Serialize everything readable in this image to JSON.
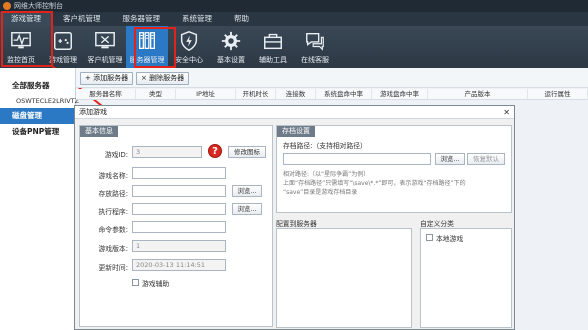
{
  "window": {
    "title": "网维大师控制台"
  },
  "menu": [
    "游戏管理",
    "客户机管理",
    "服务器管理",
    "系统管理",
    "帮助"
  ],
  "toolbar": [
    {
      "label": "监控首页",
      "icon": "monitor-pulse-icon"
    },
    {
      "label": "游戏管理",
      "icon": "gamepad-icon"
    },
    {
      "label": "客户机管理",
      "icon": "computer-tools-icon"
    },
    {
      "label": "服务器管理",
      "icon": "server-icon"
    },
    {
      "label": "安全中心",
      "icon": "shield-bolt-icon"
    },
    {
      "label": "基本设置",
      "icon": "gear-icon"
    },
    {
      "label": "辅助工具",
      "icon": "toolbox-icon"
    },
    {
      "label": "在线客服",
      "icon": "chat-icon"
    }
  ],
  "sidebar": {
    "all_servers": "全部服务器",
    "server_id": "OSWTECLE2LRIVTZ",
    "disk_mgmt": "磁盘管理",
    "pnp_mgmt": "设备PNP管理"
  },
  "actions": {
    "add_server": "添加服务器",
    "delete_server": "删除服务器"
  },
  "table_headers": [
    "服务器名称",
    "类型",
    "IP地址",
    "开机时长",
    "连接数",
    "系统盘命中率",
    "游戏盘命中率",
    "产品版本",
    "运行属性"
  ],
  "dialog": {
    "title": "添加游戏",
    "basic": {
      "heading": "基本信息",
      "game_id_label": "游戏ID:",
      "game_id_value": "3",
      "change_icon": "修改图标",
      "game_name_label": "游戏名称:",
      "save_path_label": "存放路径:",
      "exec_label": "执行程序:",
      "cmd_label": "命令参数:",
      "version_label": "游戏版本:",
      "version_value": "1",
      "updated_label": "更新时间:",
      "updated_value": "2020-03-13 11:14:51",
      "browse": "浏览...",
      "assist_label": "游戏辅助"
    },
    "archive": {
      "heading": "存档设置",
      "path_label": "存档路径:（支持相对路径）",
      "browse": "浏览...",
      "restore": "恢复默认",
      "note1": "相对路径:（以“星际争霸”为例）",
      "note2": "上面“存档路径”只需填写“\\save\\*.*”即可，表示游戏“存档路径”下的",
      "note3": "“save”目录是游戏存档目录"
    },
    "deploy": {
      "heading": "配置到服务器"
    },
    "category": {
      "heading": "自定义分类",
      "item": "本地游戏"
    }
  },
  "colors": {
    "accent": "#2b78c4",
    "highlight": "#e0241b"
  }
}
